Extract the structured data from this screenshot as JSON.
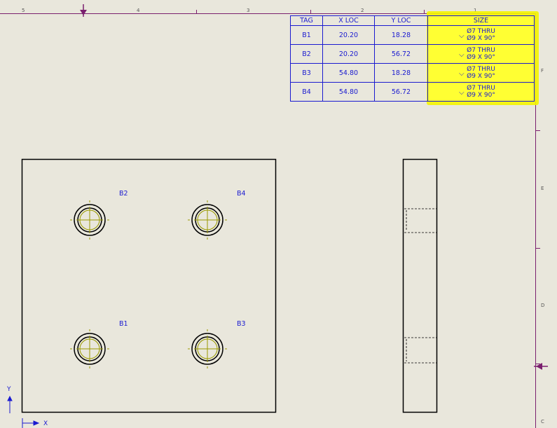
{
  "border": {
    "top_zones": [
      "5",
      "4",
      "3",
      "2",
      "1"
    ],
    "right_zones": [
      "F",
      "E",
      "D",
      "C"
    ]
  },
  "hole_table": {
    "headers": [
      "TAG",
      "X LOC",
      "Y LOC",
      "SIZE"
    ],
    "rows": [
      {
        "tag": "B1",
        "x": "20.20",
        "y": "18.28",
        "size_line1": "Ø7 THRU",
        "size_line2": "Ø9 X 90°"
      },
      {
        "tag": "B2",
        "x": "20.20",
        "y": "56.72",
        "size_line1": "Ø7 THRU",
        "size_line2": "Ø9 X 90°"
      },
      {
        "tag": "B3",
        "x": "54.80",
        "y": "18.28",
        "size_line1": "Ø7 THRU",
        "size_line2": "Ø9 X 90°"
      },
      {
        "tag": "B4",
        "x": "54.80",
        "y": "56.72",
        "size_line1": "Ø7 THRU",
        "size_line2": "Ø9 X 90°"
      }
    ],
    "highlight_color": "#ffff33"
  },
  "front_view": {
    "hole_labels": {
      "b1": "B1",
      "b2": "B2",
      "b3": "B3",
      "b4": "B4"
    }
  },
  "origin": {
    "x_label": "X",
    "y_label": "Y"
  },
  "colors": {
    "sheet": "#e9e7dc",
    "annotation": "#1a1ad0",
    "border_marker": "#7a1f6e",
    "centerline": "#9a9a00"
  }
}
